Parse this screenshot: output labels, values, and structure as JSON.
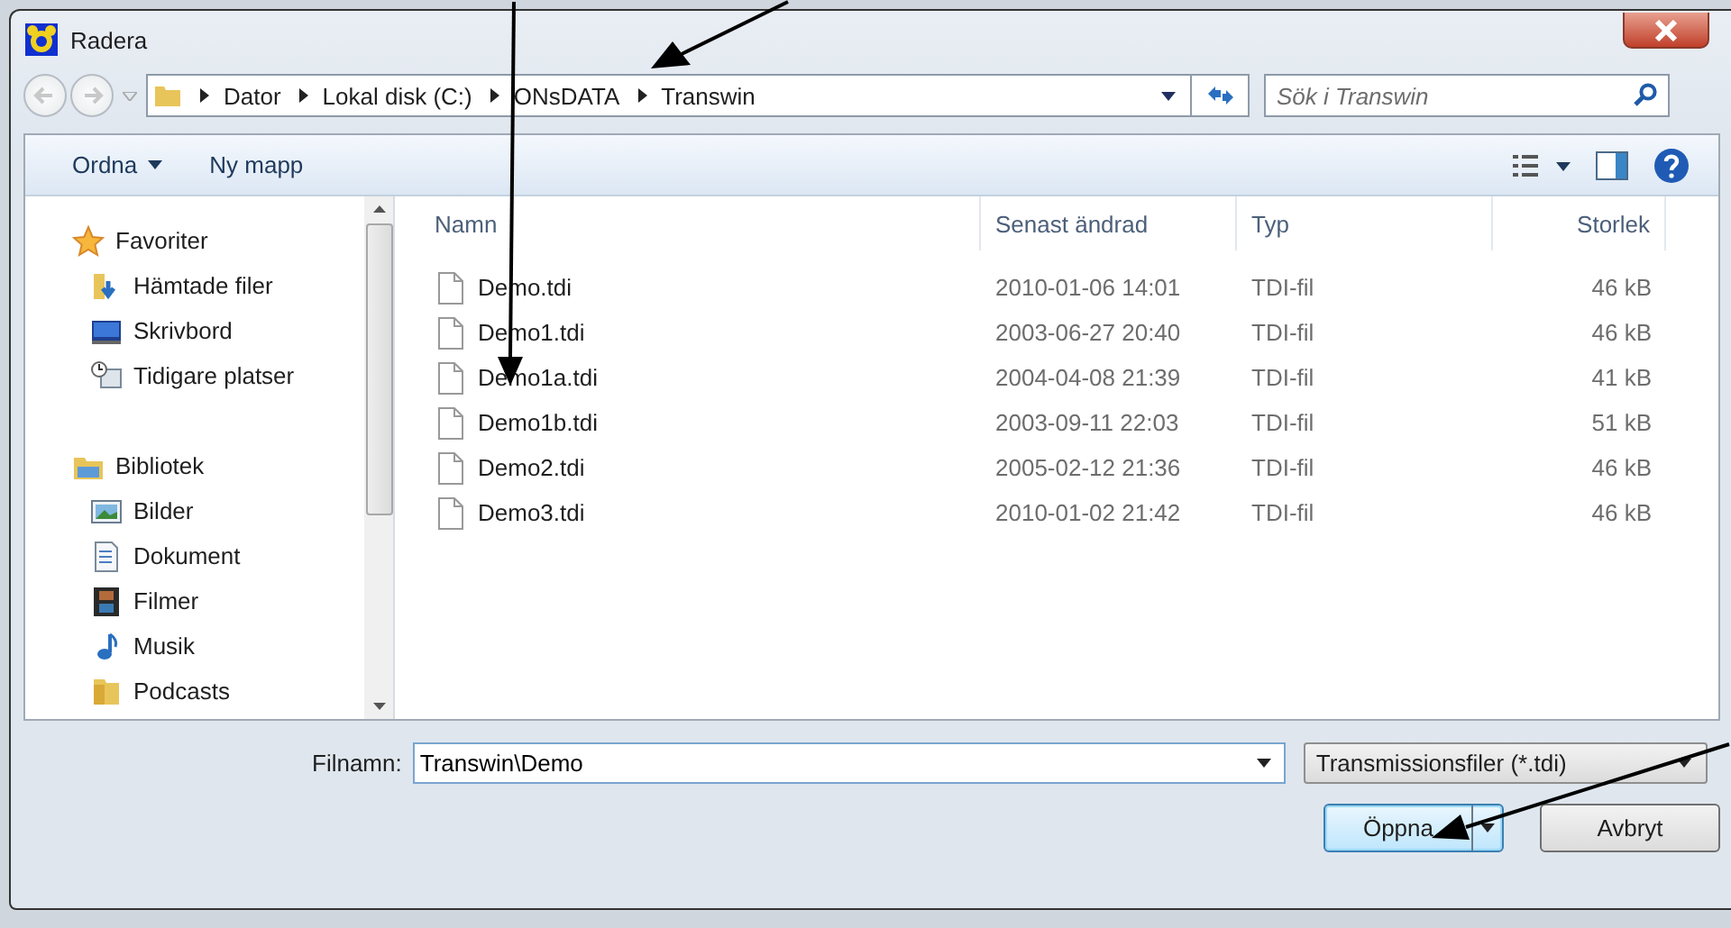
{
  "window": {
    "title": "Radera"
  },
  "address": {
    "segments": [
      "Dator",
      "Lokal disk (C:)",
      "ONsDATA",
      "Transwin"
    ]
  },
  "search": {
    "placeholder": "Sök i Transwin"
  },
  "toolbar": {
    "buttons": [
      {
        "label": "Ordna",
        "dropdown": true
      },
      {
        "label": "Ny mapp",
        "dropdown": false
      }
    ]
  },
  "sidebar": {
    "groups": [
      {
        "label": "Favoriter",
        "kind": "star",
        "children": [
          {
            "label": "Hämtade filer",
            "kind": "downloads"
          },
          {
            "label": "Skrivbord",
            "kind": "desktop"
          },
          {
            "label": "Tidigare platser",
            "kind": "recent"
          }
        ]
      },
      {
        "label": "Bibliotek",
        "kind": "library",
        "children": [
          {
            "label": "Bilder",
            "kind": "pictures"
          },
          {
            "label": "Dokument",
            "kind": "document"
          },
          {
            "label": "Filmer",
            "kind": "film"
          },
          {
            "label": "Musik",
            "kind": "music"
          },
          {
            "label": "Podcasts",
            "kind": "folder"
          }
        ]
      }
    ]
  },
  "table": {
    "columns": [
      "Namn",
      "Senast ändrad",
      "Typ",
      "Storlek"
    ],
    "rows": [
      {
        "name": "Demo.tdi",
        "modified": "2010-01-06 14:01",
        "type": "TDI-fil",
        "size": "46 kB"
      },
      {
        "name": "Demo1.tdi",
        "modified": "2003-06-27 20:40",
        "type": "TDI-fil",
        "size": "46 kB"
      },
      {
        "name": "Demo1a.tdi",
        "modified": "2004-04-08 21:39",
        "type": "TDI-fil",
        "size": "41 kB"
      },
      {
        "name": "Demo1b.tdi",
        "modified": "2003-09-11 22:03",
        "type": "TDI-fil",
        "size": "51 kB"
      },
      {
        "name": "Demo2.tdi",
        "modified": "2005-02-12 21:36",
        "type": "TDI-fil",
        "size": "46 kB"
      },
      {
        "name": "Demo3.tdi",
        "modified": "2010-01-02 21:42",
        "type": "TDI-fil",
        "size": "46 kB"
      }
    ]
  },
  "filename": {
    "label": "Filnamn:",
    "value": "Transwin\\Demo"
  },
  "filetype": {
    "value": "Transmissionsfiler (*.tdi)"
  },
  "buttons": [
    {
      "label": "Öppna",
      "kind": "split",
      "default": true
    },
    {
      "label": "Avbryt",
      "kind": "plain",
      "default": false
    }
  ]
}
